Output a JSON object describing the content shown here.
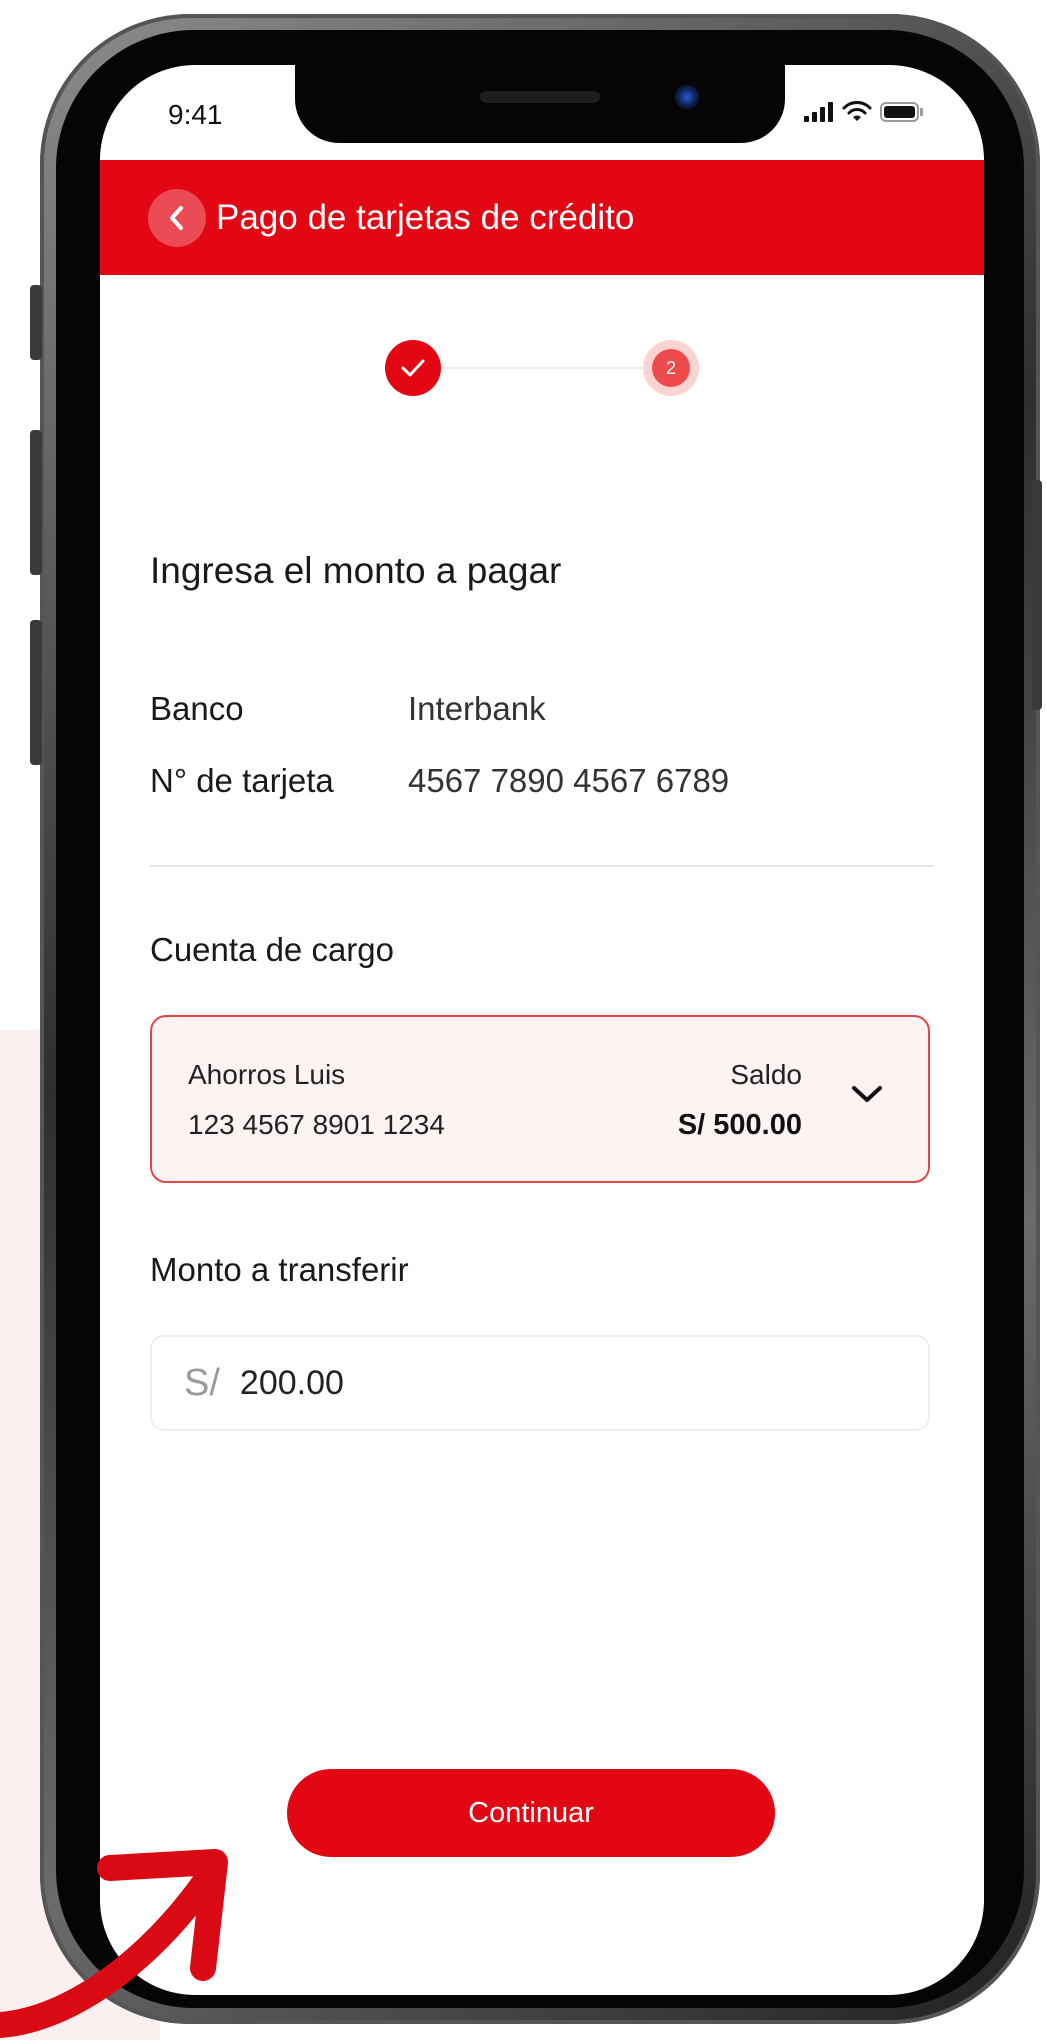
{
  "status_bar": {
    "time": "9:41"
  },
  "header": {
    "title": "Pago de tarjetas de crédito",
    "back_icon": "chevron-left-icon"
  },
  "stepper": {
    "steps": [
      {
        "state": "completed",
        "icon": "check-icon"
      },
      {
        "state": "current",
        "number": "2"
      }
    ]
  },
  "main": {
    "title": "Ingresa el monto a pagar",
    "details": [
      {
        "label": "Banco",
        "value": "Interbank"
      },
      {
        "label": "N° de tarjeta",
        "value": "4567 7890 4567 6789"
      }
    ],
    "account_section": {
      "label": "Cuenta de cargo",
      "selected": {
        "name": "Ahorros Luis",
        "number": "123 4567 8901 1234",
        "balance_label": "Saldo",
        "balance_value": "S/ 500.00"
      }
    },
    "amount_section": {
      "label": "Monto a transferir",
      "currency": "S/",
      "value": "200.00"
    },
    "continue_label": "Continuar"
  },
  "colors": {
    "primary": "#e30613",
    "account_border": "#e04848",
    "account_bg": "#fdf3f3",
    "arrow": "#d90a14"
  }
}
